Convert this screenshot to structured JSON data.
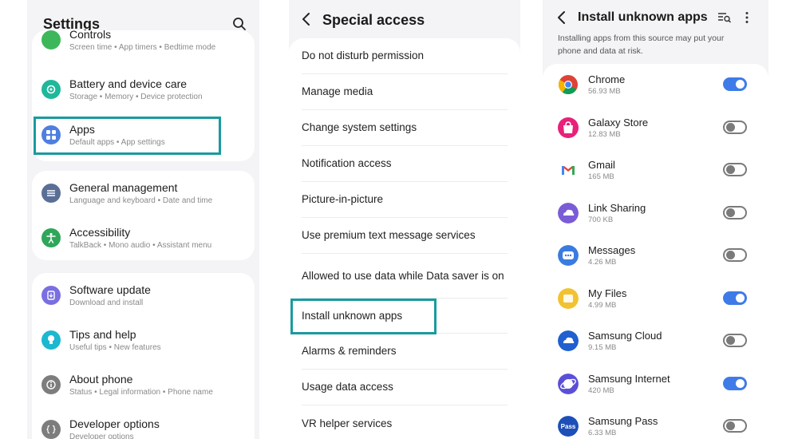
{
  "settings_panel": {
    "title": "Settings",
    "top_partial": {
      "title": "Controls",
      "subtitle": "Screen time • App timers • Bedtime mode"
    },
    "groups": [
      {
        "items": [
          {
            "title": "Battery and device care",
            "subtitle": "Storage • Memory • Device protection",
            "icon": "battery-care-icon",
            "color": "#1fb89a"
          },
          {
            "title": "Apps",
            "subtitle": "Default apps • App settings",
            "icon": "apps-grid-icon",
            "color": "#4e7fe0"
          }
        ]
      },
      {
        "items": [
          {
            "title": "General management",
            "subtitle": "Language and keyboard • Date and time",
            "icon": "sliders-icon",
            "color": "#5a6f95"
          },
          {
            "title": "Accessibility",
            "subtitle": "TalkBack • Mono audio • Assistant menu",
            "icon": "accessibility-person-icon",
            "color": "#2fa65a"
          }
        ]
      },
      {
        "items": [
          {
            "title": "Software update",
            "subtitle": "Download and install",
            "icon": "software-update-icon",
            "color": "#7a6fe0"
          },
          {
            "title": "Tips and help",
            "subtitle": "Useful tips • New features",
            "icon": "lightbulb-icon",
            "color": "#1bb8d0"
          },
          {
            "title": "About phone",
            "subtitle": "Status • Legal information • Phone name",
            "icon": "info-icon",
            "color": "#7d7d7d"
          },
          {
            "title": "Developer options",
            "subtitle": "Developer options",
            "icon": "code-braces-icon",
            "color": "#7d7d7d"
          }
        ]
      }
    ]
  },
  "special_access_panel": {
    "title": "Special access",
    "items": [
      "Do not disturb permission",
      "Manage media",
      "Change system settings",
      "Notification access",
      "Picture-in-picture",
      "Use premium text message services",
      "Allowed to use data while Data saver is on",
      "Install unknown apps",
      "Alarms & reminders",
      "Usage data access",
      "VR helper services"
    ]
  },
  "install_unknown_panel": {
    "title": "Install unknown apps",
    "warning": "Installing apps from this source may put your phone and data at risk.",
    "apps": [
      {
        "name": "Chrome",
        "size": "56.93 MB",
        "enabled": true,
        "icon": "chrome-icon"
      },
      {
        "name": "Galaxy Store",
        "size": "12.83 MB",
        "enabled": false,
        "icon": "galaxy-store-icon"
      },
      {
        "name": "Gmail",
        "size": "165 MB",
        "enabled": false,
        "icon": "gmail-icon"
      },
      {
        "name": "Link Sharing",
        "size": "700 KB",
        "enabled": false,
        "icon": "link-sharing-icon"
      },
      {
        "name": "Messages",
        "size": "4.26 MB",
        "enabled": false,
        "icon": "messages-icon"
      },
      {
        "name": "My Files",
        "size": "4.99 MB",
        "enabled": true,
        "icon": "my-files-icon"
      },
      {
        "name": "Samsung Cloud",
        "size": "9.15 MB",
        "enabled": false,
        "icon": "samsung-cloud-icon"
      },
      {
        "name": "Samsung Internet",
        "size": "420 MB",
        "enabled": true,
        "icon": "samsung-internet-icon"
      },
      {
        "name": "Samsung Pass",
        "size": "6.33 MB",
        "enabled": false,
        "icon": "samsung-pass-icon",
        "icon_text": "Pass"
      }
    ]
  },
  "colors": {
    "highlight": "#1a9aa0",
    "toggle_on": "#3e7be8",
    "panel_bg": "#f4f4f6"
  }
}
